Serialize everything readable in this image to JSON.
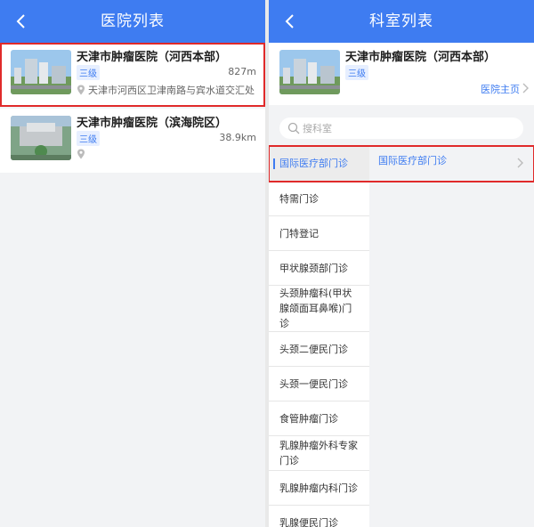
{
  "left": {
    "title": "医院列表",
    "hospitals": [
      {
        "name": "天津市肿瘤医院（河西本部）",
        "grade": "三级",
        "distance": "827m",
        "address": "天津市河西区卫津南路与宾水道交汇处"
      },
      {
        "name": "天津市肿瘤医院（滨海院区）",
        "grade": "三级",
        "distance": "38.9km",
        "address": ""
      }
    ]
  },
  "right": {
    "title": "科室列表",
    "hospital": {
      "name": "天津市肿瘤医院（河西本部）",
      "grade": "三级",
      "home_link": "医院主页"
    },
    "search_placeholder": "搜科室",
    "departments": [
      "国际医疗部门诊",
      "特需门诊",
      "门特登记",
      "甲状腺颈部门诊",
      "头颈肿瘤科(甲状腺颌面耳鼻喉)门诊",
      "头颈二便民门诊",
      "头颈一便民门诊",
      "食管肿瘤门诊",
      "乳腺肿瘤外科专家门诊",
      "乳腺肿瘤内科门诊",
      "乳腺便民门诊"
    ],
    "selected_department": "国际医疗部门诊",
    "sub_departments": [
      "国际医疗部门诊"
    ]
  },
  "colors": {
    "primary": "#3e7cf1",
    "highlight": "#e02a2a"
  }
}
